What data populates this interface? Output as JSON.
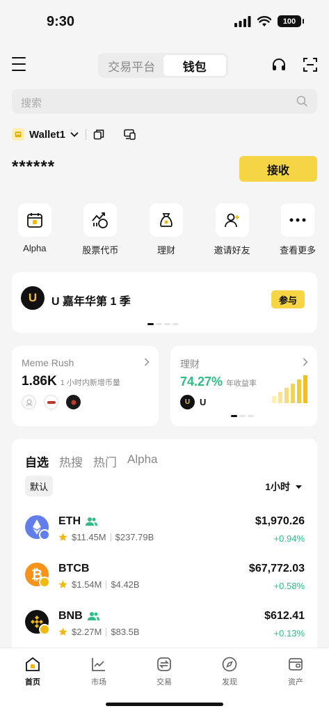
{
  "status": {
    "time": "9:30",
    "battery": "100"
  },
  "header": {
    "tabs": [
      {
        "label": "交易平台",
        "active": false
      },
      {
        "label": "钱包",
        "active": true
      }
    ]
  },
  "search": {
    "placeholder": "搜索"
  },
  "wallet": {
    "name": "Wallet1",
    "balance": "******",
    "receive_label": "接收"
  },
  "quick_actions": [
    {
      "label": "Alpha",
      "icon": "calendar-alpha-icon"
    },
    {
      "label": "股票代币",
      "icon": "stock-chart-icon"
    },
    {
      "label": "理财",
      "icon": "money-bag-icon"
    },
    {
      "label": "邀请好友",
      "icon": "invite-friend-icon"
    },
    {
      "label": "查看更多",
      "icon": "more-icon"
    }
  ],
  "banner": {
    "title": "U 嘉年华第 1 季",
    "join_label": "参与"
  },
  "meme_card": {
    "title": "Meme Rush",
    "value": "1.86K",
    "subtitle": "1 小时内新增币量"
  },
  "earn_card": {
    "title": "理财",
    "value": "74.27%",
    "subtitle": "年收益率",
    "token": "U"
  },
  "token_list": {
    "tabs": [
      "自选",
      "热搜",
      "热门",
      "Alpha"
    ],
    "active_tab": "自选",
    "filter_chip": "默认",
    "timeframe": "1小时",
    "tokens": [
      {
        "symbol": "ETH",
        "volume": "$11.45M",
        "mcap": "$237.79B",
        "price": "$1,970.26",
        "change": "+0.94%",
        "logo_color": "#627eea"
      },
      {
        "symbol": "BTCB",
        "volume": "$1.54M",
        "mcap": "$4.42B",
        "price": "$67,772.03",
        "change": "+0.58%",
        "logo_color": "#f7931a"
      },
      {
        "symbol": "BNB",
        "volume": "$2.27M",
        "mcap": "$83.5B",
        "price": "$612.41",
        "change": "+0.13%",
        "logo_color": "#111111"
      }
    ]
  },
  "nav": [
    {
      "label": "首页",
      "icon": "home-icon",
      "active": true
    },
    {
      "label": "市场",
      "icon": "market-chart-icon",
      "active": false
    },
    {
      "label": "交易",
      "icon": "trade-swap-icon",
      "active": false
    },
    {
      "label": "发现",
      "icon": "discover-compass-icon",
      "active": false
    },
    {
      "label": "资产",
      "icon": "wallet-assets-icon",
      "active": false
    }
  ],
  "colors": {
    "accent": "#f5d544",
    "positive": "#2ebd85",
    "background": "#f5f5f5"
  }
}
